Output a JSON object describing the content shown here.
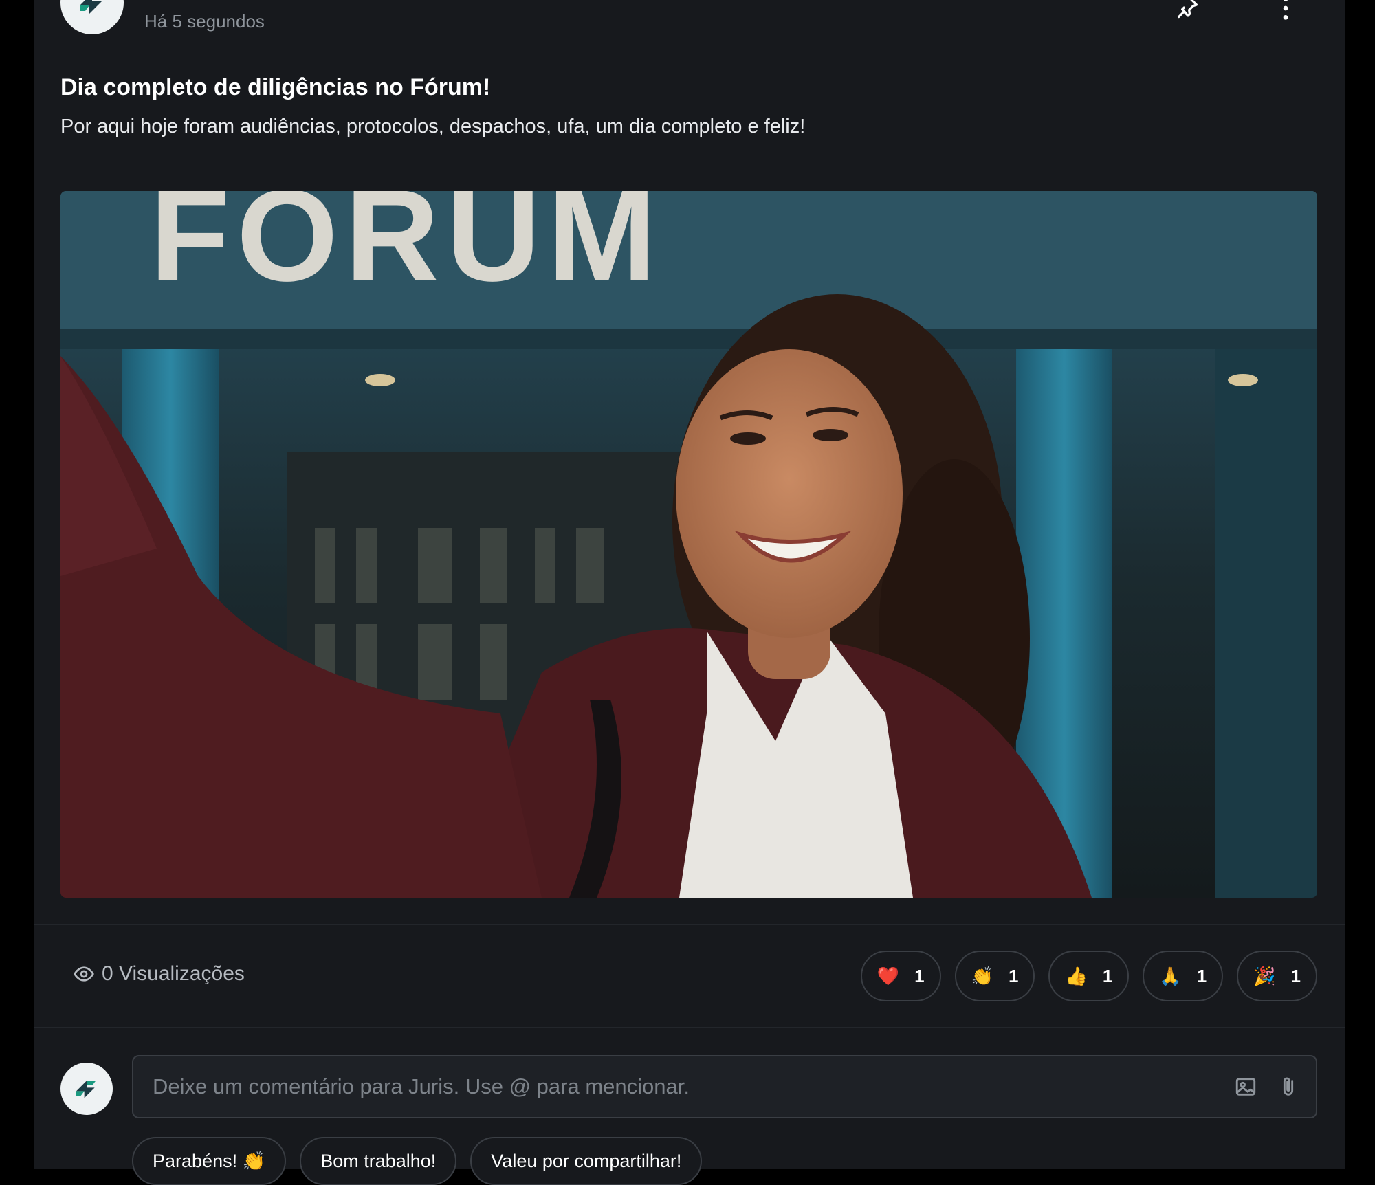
{
  "post": {
    "timestamp": "Há 5 segundos",
    "title": "Dia completo de diligências no Fórum!",
    "body": "Por aqui hoje foram audiências, protocolos, despachos, ufa, um dia completo e feliz!",
    "image": {
      "sign_text": "FÓRUM"
    }
  },
  "stats": {
    "views_label": "0 Visualizações"
  },
  "reactions": [
    {
      "emoji": "❤️",
      "count": "1",
      "icon": "heart-icon"
    },
    {
      "emoji": "👏",
      "count": "1",
      "icon": "clap-icon"
    },
    {
      "emoji": "👍",
      "count": "1",
      "icon": "thumbs-up-icon"
    },
    {
      "emoji": "🙏",
      "count": "1",
      "icon": "pray-icon"
    },
    {
      "emoji": "🎉",
      "count": "1",
      "icon": "party-icon"
    }
  ],
  "comment": {
    "placeholder": "Deixe um comentário para Juris. Use @ para mencionar."
  },
  "quick_replies": [
    {
      "label": "Parabéns! 👏"
    },
    {
      "label": "Bom trabalho!"
    },
    {
      "label": "Valeu por compartilhar!"
    }
  ],
  "colors": {
    "background": "#000000",
    "card": "#17191d",
    "brand_accent": "#1a9a80",
    "brand_dark": "#1d3b44"
  }
}
